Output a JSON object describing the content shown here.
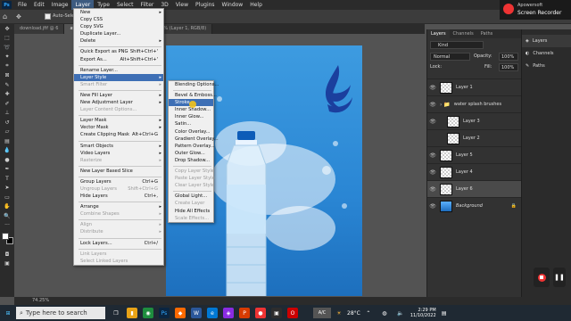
{
  "menubar": {
    "app_icon": "Ps",
    "items": [
      "File",
      "Edit",
      "Image",
      "Layer",
      "Type",
      "Select",
      "Filter",
      "3D",
      "View",
      "Plugins",
      "Window",
      "Help"
    ],
    "active": "Layer"
  },
  "options_bar": {
    "auto_select": "Auto-Select"
  },
  "doc_tabs": [
    {
      "label": "download.jfif @ 6"
    },
    {
      "label": "ayer 6, RGB/8#) *"
    },
    {
      "label": "favicon.png @ 100% (Layer 1, RGB/8)"
    }
  ],
  "layer_menu": [
    {
      "label": "New",
      "arrow": true
    },
    {
      "label": "Copy CSS"
    },
    {
      "label": "Copy SVG"
    },
    {
      "label": "Duplicate Layer..."
    },
    {
      "label": "Delete",
      "arrow": true
    },
    {
      "sep": true
    },
    {
      "label": "Quick Export as PNG",
      "shortcut": "Shift+Ctrl+'"
    },
    {
      "label": "Export As...",
      "shortcut": "Alt+Shift+Ctrl+'"
    },
    {
      "sep": true
    },
    {
      "label": "Rename Layer..."
    },
    {
      "label": "Layer Style",
      "arrow": true,
      "highlight": true
    },
    {
      "label": "Smart Filter",
      "arrow": true,
      "disabled": true
    },
    {
      "sep": true
    },
    {
      "label": "New Fill Layer",
      "arrow": true
    },
    {
      "label": "New Adjustment Layer",
      "arrow": true
    },
    {
      "label": "Layer Content Options...",
      "disabled": true
    },
    {
      "sep": true
    },
    {
      "label": "Layer Mask",
      "arrow": true
    },
    {
      "label": "Vector Mask",
      "arrow": true
    },
    {
      "label": "Create Clipping Mask",
      "shortcut": "Alt+Ctrl+G"
    },
    {
      "sep": true
    },
    {
      "label": "Smart Objects",
      "arrow": true
    },
    {
      "label": "Video Layers",
      "arrow": true
    },
    {
      "label": "Rasterize",
      "arrow": true,
      "disabled": true
    },
    {
      "sep": true
    },
    {
      "label": "New Layer Based Slice"
    },
    {
      "sep": true
    },
    {
      "label": "Group Layers",
      "shortcut": "Ctrl+G"
    },
    {
      "label": "Ungroup Layers",
      "shortcut": "Shift+Ctrl+G",
      "disabled": true
    },
    {
      "label": "Hide Layers",
      "shortcut": "Ctrl+,"
    },
    {
      "sep": true
    },
    {
      "label": "Arrange",
      "arrow": true
    },
    {
      "label": "Combine Shapes",
      "arrow": true,
      "disabled": true
    },
    {
      "sep": true
    },
    {
      "label": "Align",
      "arrow": true,
      "disabled": true
    },
    {
      "label": "Distribute",
      "arrow": true,
      "disabled": true
    },
    {
      "sep": true
    },
    {
      "label": "Lock Layers...",
      "shortcut": "Ctrl+/"
    },
    {
      "sep": true
    },
    {
      "label": "Link Layers",
      "disabled": true
    },
    {
      "label": "Select Linked Layers",
      "disabled": true
    }
  ],
  "layer_style_menu": [
    {
      "label": "Blending Options..."
    },
    {
      "sep": true
    },
    {
      "label": "Bevel & Emboss..."
    },
    {
      "label": "Stroke...",
      "highlight": true
    },
    {
      "label": "Inner Shadow..."
    },
    {
      "label": "Inner Glow..."
    },
    {
      "label": "Satin..."
    },
    {
      "label": "Color Overlay..."
    },
    {
      "label": "Gradient Overlay..."
    },
    {
      "label": "Pattern Overlay..."
    },
    {
      "label": "Outer Glow..."
    },
    {
      "label": "Drop Shadow..."
    },
    {
      "sep": true
    },
    {
      "label": "Copy Layer Style",
      "disabled": true
    },
    {
      "label": "Paste Layer Style",
      "disabled": true
    },
    {
      "label": "Clear Layer Style",
      "disabled": true
    },
    {
      "sep": true
    },
    {
      "label": "Global Light..."
    },
    {
      "label": "Create Layer",
      "disabled": true
    },
    {
      "label": "Hide All Effects"
    },
    {
      "label": "Scale Effects...",
      "disabled": true
    }
  ],
  "layers_panel": {
    "tabs": [
      "Layers",
      "Channels",
      "Paths"
    ],
    "kind": "Kind",
    "blend": "Normal",
    "opacity_label": "Opacity:",
    "opacity": "100%",
    "lock_label": "Lock:",
    "fill_label": "Fill:",
    "fill": "100%",
    "layers": [
      {
        "name": "Layer 1",
        "thumb": "check"
      },
      {
        "name": "water splash brushes",
        "thumb": "folder"
      },
      {
        "name": "Layer 3",
        "thumb": "check",
        "indent": true
      },
      {
        "name": "Layer 2",
        "thumb": "check",
        "indent": true
      },
      {
        "name": "Layer 5",
        "thumb": "check"
      },
      {
        "name": "Layer 4",
        "thumb": "check"
      },
      {
        "name": "Layer 6",
        "thumb": "check",
        "selected": true
      },
      {
        "name": "Background",
        "thumb": "blue",
        "italic": true
      }
    ]
  },
  "mini_panel": {
    "items": [
      "Layers",
      "Channels",
      "Paths"
    ]
  },
  "recorder": {
    "brand": "Apowersoft",
    "title": "Screen Recorder"
  },
  "status": {
    "zoom": "74.25%"
  },
  "taskbar": {
    "search_placeholder": "Type here to search",
    "weather_temp": "28°C",
    "time": "2:29 PM",
    "date": "11/10/2022",
    "input_indicator": "A/C"
  }
}
